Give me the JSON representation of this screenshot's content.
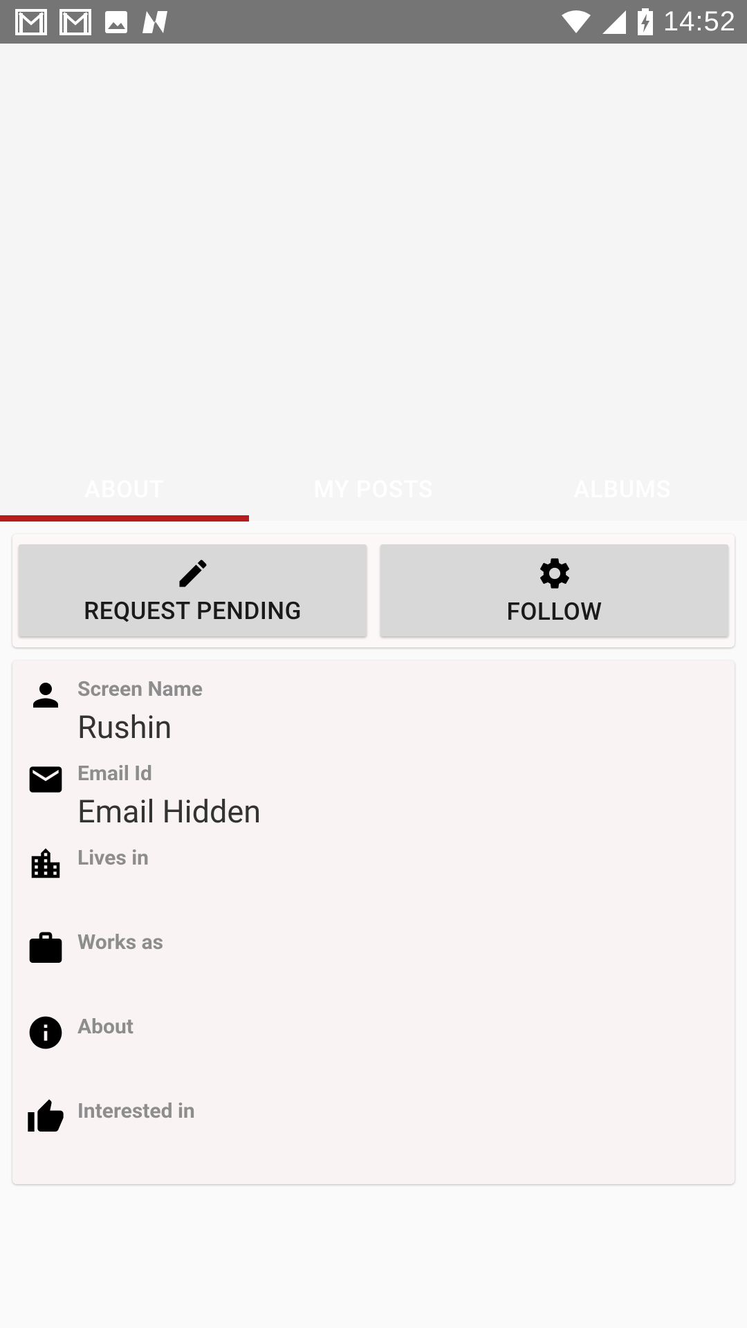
{
  "status_bar": {
    "time": "14:52",
    "left_icons": [
      "gmail-icon",
      "gmail-icon",
      "image-icon",
      "n-app-icon"
    ],
    "right_icons": [
      "wifi-icon",
      "signal-icon",
      "battery-charging-icon"
    ]
  },
  "tabs": [
    {
      "label": "ABOUT",
      "selected": true
    },
    {
      "label": "MY POSTS",
      "selected": false
    },
    {
      "label": "ALBUMS",
      "selected": false
    }
  ],
  "actions": {
    "request": {
      "label": "REQUEST PENDING",
      "icon": "pencil-icon"
    },
    "follow": {
      "label": "FOLLOW",
      "icon": "gear-icon"
    }
  },
  "profile": {
    "screen_name": {
      "label": "Screen Name",
      "value": "Rushin",
      "icon": "person-icon"
    },
    "email": {
      "label": "Email Id",
      "value": "Email Hidden",
      "icon": "email-icon"
    },
    "lives_in": {
      "label": "Lives in",
      "value": "",
      "icon": "city-icon"
    },
    "works_as": {
      "label": "Works as",
      "value": "",
      "icon": "briefcase-icon"
    },
    "about": {
      "label": "About",
      "value": "",
      "icon": "info-icon"
    },
    "interested_in": {
      "label": "Interested in",
      "value": "",
      "icon": "thumbs-up-icon"
    }
  },
  "colors": {
    "status_bar": "#757575",
    "tab_indicator": "#b71c1c",
    "card_bg": "#f9f3f3",
    "button_bg": "#d8d8d8"
  }
}
